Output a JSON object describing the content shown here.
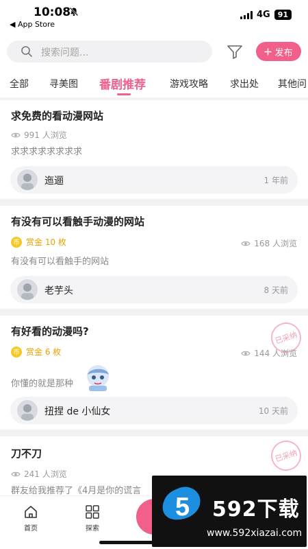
{
  "status_bar": {
    "time": "10:08",
    "back_app": "◀ App Store",
    "network": "4G",
    "battery": "91"
  },
  "search": {
    "placeholder": "搜索问题..."
  },
  "publish_button": {
    "label": "发布",
    "icon": "plus-icon"
  },
  "tabs": [
    {
      "label": "全部",
      "active": false
    },
    {
      "label": "寻美图",
      "active": false
    },
    {
      "label": "番剧推荐",
      "active": true
    },
    {
      "label": "游戏攻略",
      "active": false
    },
    {
      "label": "求出处",
      "active": false
    },
    {
      "label": "其他问",
      "active": false
    }
  ],
  "posts": [
    {
      "title": "求免费的看动漫网站",
      "views": "991 人浏览",
      "bounty": null,
      "description": "求求求求求求求求",
      "author": "迤逦",
      "time": "1 年前",
      "adopted": false
    },
    {
      "title": "有没有可以看触手动漫的网站",
      "views": "168 人浏览",
      "bounty": "赏金 10 枚",
      "description": "有没有可以看触手的网站",
      "author": "老芋头",
      "time": "8 天前",
      "adopted": false
    },
    {
      "title": "有好看的动漫吗?",
      "views": "144 人浏览",
      "bounty": "赏金 6 枚",
      "description": "你懂的就是那种",
      "author": "扭捏 de 小仙女",
      "time": "10 天前",
      "adopted": true,
      "adopted_label": "已采纳"
    },
    {
      "title": "刀不刀",
      "views": "241 人浏览",
      "bounty": null,
      "description": "群友给我推荐了《4月是你的谎言",
      "adopted": true,
      "adopted_label": "已采纳"
    }
  ],
  "coin_symbol": "币",
  "bottom_nav": [
    {
      "label": "首页",
      "icon": "home-icon"
    },
    {
      "label": "探索",
      "icon": "grid-icon"
    }
  ],
  "watermark": {
    "badge": "5",
    "brand": "592下载",
    "url": "www.592xiazai.com"
  },
  "colors": {
    "accent": "#f0608a",
    "bounty": "#e8a400",
    "coin": "#f6c823"
  }
}
